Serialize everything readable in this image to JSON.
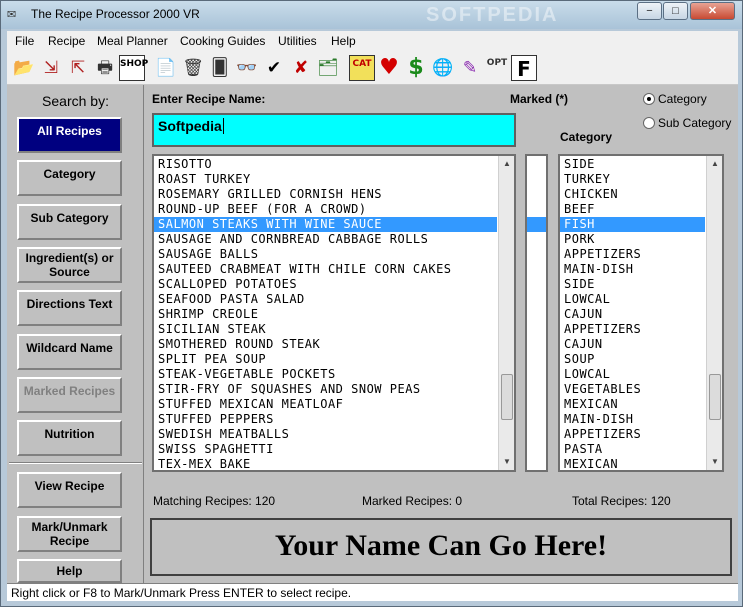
{
  "window": {
    "title": "The Recipe Processor 2000 VR",
    "watermark": "SOFTPEDIA",
    "controls": {
      "minimize": "−",
      "maximize": "□",
      "close": "✕"
    }
  },
  "menu": [
    "File",
    "Recipe",
    "Meal Planner",
    "Cooking Guides",
    "Utilities",
    "Help"
  ],
  "toolbar": [
    {
      "icon": "open-folder-icon",
      "glyph": "📂"
    },
    {
      "icon": "import-icon",
      "glyph": "⇲"
    },
    {
      "icon": "export-icon",
      "glyph": "⇱"
    },
    {
      "icon": "print-icon",
      "glyph": "🖶"
    },
    {
      "icon": "shop-icon",
      "glyph": "SHOP"
    },
    {
      "icon": "document-icon",
      "glyph": "📄"
    },
    {
      "icon": "trash-icon",
      "glyph": "🗑"
    },
    {
      "icon": "cards-icon",
      "glyph": "🂠"
    },
    {
      "icon": "glasses-icon",
      "glyph": "👓"
    },
    {
      "icon": "check-icon",
      "glyph": "✔"
    },
    {
      "icon": "cross-icon",
      "glyph": "✘"
    },
    {
      "icon": "card-file-icon",
      "glyph": "🗂"
    },
    {
      "icon": "cat-icon",
      "glyph": "CAT"
    },
    {
      "icon": "heart-icon",
      "glyph": "♥"
    },
    {
      "icon": "dollar-icon",
      "glyph": "$"
    },
    {
      "icon": "globe-icon",
      "glyph": "🌐"
    },
    {
      "icon": "crayons-icon",
      "glyph": "✎"
    },
    {
      "icon": "options-icon",
      "glyph": "OPT"
    },
    {
      "icon": "f-icon",
      "glyph": "F"
    }
  ],
  "colors": {
    "accent": "#000080",
    "input_bg": "#00ffff",
    "selection": "#3399ff"
  },
  "sidebar": {
    "title": "Search by:",
    "buttons": [
      "All Recipes",
      "Category",
      "Sub Category",
      "Ingredient(s) or Source",
      "Directions Text",
      "Wildcard Name",
      "Marked Recipes",
      "Nutrition"
    ],
    "actions": [
      "View Recipe",
      "Mark/Unmark Recipe",
      "Help"
    ]
  },
  "form": {
    "enter_label": "Enter Recipe Name:",
    "recipe_name": "Softpedia",
    "marked_label": "Marked (*)",
    "category_label": "Category",
    "radio_category": "Category",
    "radio_subcategory": "Sub Category"
  },
  "recipes": [
    "RISOTTO",
    "ROAST TURKEY",
    "ROSEMARY GRILLED CORNISH HENS",
    "ROUND-UP BEEF (FOR A CROWD)",
    "SALMON STEAKS WITH WINE SAUCE",
    "SAUSAGE AND CORNBREAD CABBAGE ROLLS",
    "SAUSAGE BALLS",
    "SAUTEED CRABMEAT WITH CHILE CORN CAKES",
    "SCALLOPED POTATOES",
    "SEAFOOD PASTA SALAD",
    "SHRIMP CREOLE",
    "SICILIAN STEAK",
    "SMOTHERED ROUND STEAK",
    "SPLIT PEA SOUP",
    "STEAK-VEGETABLE POCKETS",
    "STIR-FRY OF SQUASHES AND SNOW PEAS",
    "STUFFED MEXICAN MEATLOAF",
    "STUFFED PEPPERS",
    "SWEDISH MEATBALLS",
    "SWISS SPAGHETTI",
    "TEX-MEX BAKE"
  ],
  "categories": [
    "SIDE",
    "TURKEY",
    "CHICKEN",
    "BEEF",
    "FISH",
    "PORK",
    "APPETIZERS",
    "MAIN-DISH",
    "SIDE",
    "LOWCAL",
    "CAJUN",
    "APPETIZERS",
    "CAJUN",
    "SOUP",
    "LOWCAL",
    "VEGETABLES",
    "MEXICAN",
    "MAIN-DISH",
    "APPETIZERS",
    "PASTA",
    "MEXICAN"
  ],
  "stats": {
    "matching": "Matching Recipes: 120",
    "marked": "Marked Recipes: 0",
    "total": "Total Recipes: 120"
  },
  "banner": "Your Name Can Go Here!",
  "status": "Right click or F8 to Mark/Unmark  Press ENTER to select recipe."
}
